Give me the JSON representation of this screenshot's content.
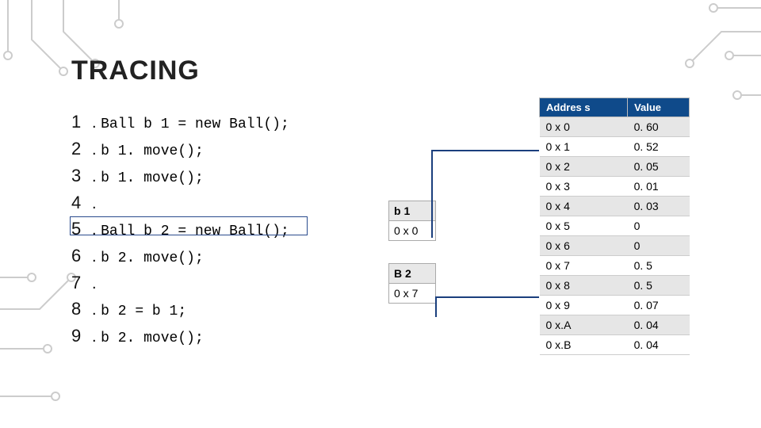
{
  "title": "TRACING",
  "code": [
    {
      "n": "1",
      "text": "Ball b 1 = new Ball();"
    },
    {
      "n": "2",
      "text": "b 1. move();"
    },
    {
      "n": "3",
      "text": "b 1. move();"
    },
    {
      "n": "4",
      "text": ""
    },
    {
      "n": "5",
      "text": "Ball b 2 = new Ball();"
    },
    {
      "n": "6",
      "text": "b 2. move();"
    },
    {
      "n": "7",
      "text": ""
    },
    {
      "n": "8",
      "text": "b 2 = b 1;"
    },
    {
      "n": "9",
      "text": "b 2. move();"
    }
  ],
  "highlighted_line_index": 4,
  "vars": {
    "b1": {
      "label": "b 1",
      "value": "0 x 0"
    },
    "b2": {
      "label": "B 2",
      "value": "0 x 7"
    }
  },
  "mem": {
    "headers": {
      "addr": "Addres s",
      "val": "Value"
    },
    "rows": [
      {
        "addr": "0 x 0",
        "val": "0. 60"
      },
      {
        "addr": "0 x 1",
        "val": "0. 52"
      },
      {
        "addr": "0 x 2",
        "val": "0. 05"
      },
      {
        "addr": "0 x 3",
        "val": "0. 01"
      },
      {
        "addr": "0 x 4",
        "val": "0. 03"
      },
      {
        "addr": "0 x 5",
        "val": "0"
      },
      {
        "addr": "0 x 6",
        "val": "0"
      },
      {
        "addr": "0 x 7",
        "val": "0. 5"
      },
      {
        "addr": "0 x 8",
        "val": "0. 5"
      },
      {
        "addr": "0 x 9",
        "val": "0. 07"
      },
      {
        "addr": "0 x.A",
        "val": "0. 04"
      },
      {
        "addr": "0 x.B",
        "val": "0. 04"
      }
    ]
  }
}
